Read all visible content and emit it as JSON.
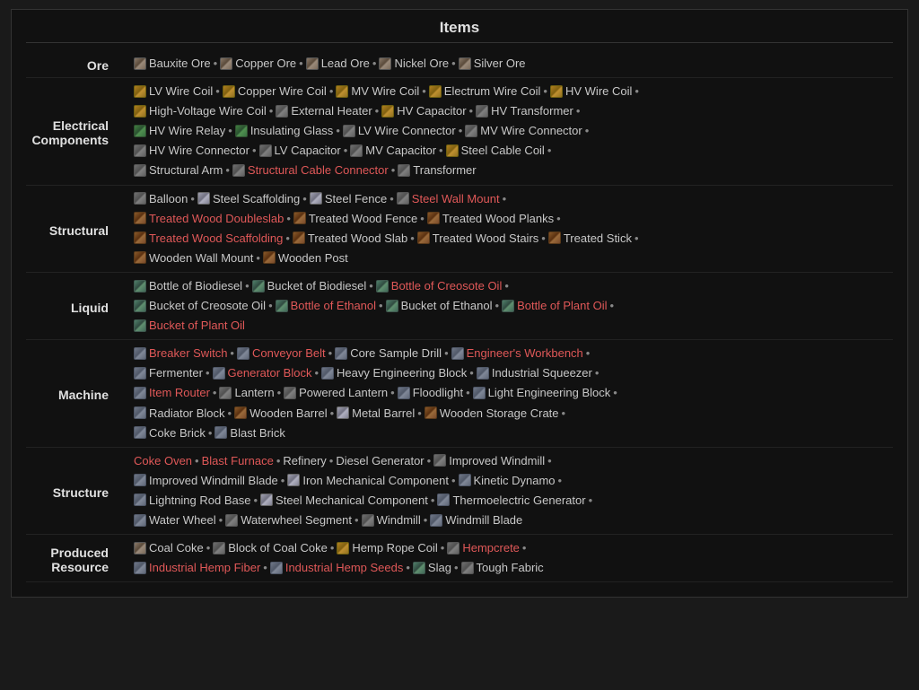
{
  "title": "Items",
  "categories": [
    {
      "id": "ore",
      "label": "Ore",
      "lines": [
        [
          {
            "icon": "ore",
            "text": "Bauxite Ore",
            "color": "white"
          },
          {
            "sep": true
          },
          {
            "icon": "ore",
            "text": "Copper Ore",
            "color": "white"
          },
          {
            "sep": true
          },
          {
            "icon": "ore",
            "text": "Lead Ore",
            "color": "white"
          },
          {
            "sep": true
          },
          {
            "icon": "ore",
            "text": "Nickel Ore",
            "color": "white"
          },
          {
            "sep": true
          },
          {
            "icon": "ore",
            "text": "Silver Ore",
            "color": "white"
          }
        ]
      ]
    },
    {
      "id": "electrical",
      "label": "Electrical\nComponents",
      "lines": [
        [
          {
            "icon": "electric",
            "text": "LV Wire Coil",
            "color": "white"
          },
          {
            "sep": true
          },
          {
            "icon": "electric",
            "text": "Copper Wire Coil",
            "color": "white"
          },
          {
            "sep": true
          },
          {
            "icon": "electric",
            "text": "MV Wire Coil",
            "color": "white"
          },
          {
            "sep": true
          },
          {
            "icon": "electric",
            "text": "Electrum Wire Coil",
            "color": "white"
          },
          {
            "sep": true
          },
          {
            "icon": "electric",
            "text": "HV Wire Coil",
            "color": "white"
          },
          {
            "sep": true
          }
        ],
        [
          {
            "icon": "electric",
            "text": "High-Voltage Wire Coil",
            "color": "white"
          },
          {
            "sep": true
          },
          {
            "icon": "generic",
            "text": "External Heater",
            "color": "white"
          },
          {
            "sep": true
          },
          {
            "icon": "electric",
            "text": "HV Capacitor",
            "color": "white"
          },
          {
            "sep": true
          },
          {
            "icon": "generic",
            "text": "HV Transformer",
            "color": "white"
          },
          {
            "sep": true
          }
        ],
        [
          {
            "icon": "green",
            "text": "HV Wire Relay",
            "color": "white"
          },
          {
            "sep": true
          },
          {
            "icon": "green",
            "text": "Insulating Glass",
            "color": "white"
          },
          {
            "sep": true
          },
          {
            "icon": "generic",
            "text": "LV Wire Connector",
            "color": "white"
          },
          {
            "sep": true
          },
          {
            "icon": "generic",
            "text": "MV Wire Connector",
            "color": "white"
          },
          {
            "sep": true
          }
        ],
        [
          {
            "icon": "generic",
            "text": "HV Wire Connector",
            "color": "white"
          },
          {
            "sep": true
          },
          {
            "icon": "generic",
            "text": "LV Capacitor",
            "color": "white"
          },
          {
            "sep": true
          },
          {
            "icon": "generic",
            "text": "MV Capacitor",
            "color": "white"
          },
          {
            "sep": true
          },
          {
            "icon": "electric",
            "text": "Steel Cable Coil",
            "color": "white"
          },
          {
            "sep": true
          }
        ],
        [
          {
            "icon": "generic",
            "text": "Structural Arm",
            "color": "white"
          },
          {
            "sep": true
          },
          {
            "icon": "generic",
            "text": "Structural Cable Connector",
            "color": "red"
          },
          {
            "sep": true
          },
          {
            "icon": "generic",
            "text": "Transformer",
            "color": "white"
          }
        ]
      ]
    },
    {
      "id": "structural",
      "label": "Structural",
      "lines": [
        [
          {
            "icon": "generic",
            "text": "Balloon",
            "color": "white"
          },
          {
            "sep": true
          },
          {
            "icon": "metal",
            "text": "Steel Scaffolding",
            "color": "white"
          },
          {
            "sep": true
          },
          {
            "icon": "metal",
            "text": "Steel Fence",
            "color": "white"
          },
          {
            "sep": true
          },
          {
            "icon": "generic",
            "text": "Steel Wall Mount",
            "color": "red"
          },
          {
            "sep": true
          }
        ],
        [
          {
            "icon": "wood",
            "text": "Treated Wood Doubleslab",
            "color": "red"
          },
          {
            "sep": true
          },
          {
            "icon": "wood",
            "text": "Treated Wood Fence",
            "color": "white"
          },
          {
            "sep": true
          },
          {
            "icon": "wood",
            "text": "Treated Wood Planks",
            "color": "white"
          },
          {
            "sep": true
          }
        ],
        [
          {
            "icon": "wood",
            "text": "Treated Wood Scaffolding",
            "color": "red"
          },
          {
            "sep": true
          },
          {
            "icon": "wood",
            "text": "Treated Wood Slab",
            "color": "white"
          },
          {
            "sep": true
          },
          {
            "icon": "wood",
            "text": "Treated Wood Stairs",
            "color": "white"
          },
          {
            "sep": true
          },
          {
            "icon": "wood",
            "text": "Treated Stick",
            "color": "white"
          },
          {
            "sep": true
          }
        ],
        [
          {
            "icon": "wood",
            "text": "Wooden Wall Mount",
            "color": "white"
          },
          {
            "sep": true
          },
          {
            "icon": "wood",
            "text": "Wooden Post",
            "color": "white"
          }
        ]
      ]
    },
    {
      "id": "liquid",
      "label": "Liquid",
      "lines": [
        [
          {
            "icon": "liquid",
            "text": "Bottle of Biodiesel",
            "color": "white"
          },
          {
            "sep": true
          },
          {
            "icon": "liquid",
            "text": "Bucket of Biodiesel",
            "color": "white"
          },
          {
            "sep": true
          },
          {
            "icon": "liquid",
            "text": "Bottle of Creosote Oil",
            "color": "red"
          },
          {
            "sep": true
          }
        ],
        [
          {
            "icon": "liquid",
            "text": "Bucket of Creosote Oil",
            "color": "white"
          },
          {
            "sep": true
          },
          {
            "icon": "liquid",
            "text": "Bottle of Ethanol",
            "color": "red"
          },
          {
            "sep": true
          },
          {
            "icon": "liquid",
            "text": "Bucket of Ethanol",
            "color": "white"
          },
          {
            "sep": true
          },
          {
            "icon": "liquid",
            "text": "Bottle of Plant Oil",
            "color": "red"
          },
          {
            "sep": true
          }
        ],
        [
          {
            "icon": "liquid",
            "text": "Bucket of Plant Oil",
            "color": "red"
          }
        ]
      ]
    },
    {
      "id": "machine",
      "label": "Machine",
      "lines": [
        [
          {
            "icon": "machine",
            "text": "Breaker Switch",
            "color": "red"
          },
          {
            "sep": true
          },
          {
            "icon": "machine",
            "text": "Conveyor Belt",
            "color": "red"
          },
          {
            "sep": true
          },
          {
            "icon": "machine",
            "text": "Core Sample Drill",
            "color": "white"
          },
          {
            "sep": true
          },
          {
            "icon": "machine",
            "text": "Engineer's Workbench",
            "color": "red"
          },
          {
            "sep": true
          }
        ],
        [
          {
            "icon": "machine",
            "text": "Fermenter",
            "color": "white"
          },
          {
            "sep": true
          },
          {
            "icon": "machine",
            "text": "Generator Block",
            "color": "red"
          },
          {
            "sep": true
          },
          {
            "icon": "machine",
            "text": "Heavy Engineering Block",
            "color": "white"
          },
          {
            "sep": true
          },
          {
            "icon": "machine",
            "text": "Industrial Squeezer",
            "color": "white"
          },
          {
            "sep": true
          }
        ],
        [
          {
            "icon": "machine",
            "text": "Item Router",
            "color": "red"
          },
          {
            "sep": true
          },
          {
            "icon": "generic",
            "text": "Lantern",
            "color": "white"
          },
          {
            "sep": true
          },
          {
            "icon": "generic",
            "text": "Powered Lantern",
            "color": "white"
          },
          {
            "sep": true
          },
          {
            "icon": "machine",
            "text": "Floodlight",
            "color": "white"
          },
          {
            "sep": true
          },
          {
            "icon": "machine",
            "text": "Light Engineering Block",
            "color": "white"
          },
          {
            "sep": true
          }
        ],
        [
          {
            "icon": "machine",
            "text": "Radiator Block",
            "color": "white"
          },
          {
            "sep": true
          },
          {
            "icon": "wood",
            "text": "Wooden Barrel",
            "color": "white"
          },
          {
            "sep": true
          },
          {
            "icon": "metal",
            "text": "Metal Barrel",
            "color": "white"
          },
          {
            "sep": true
          },
          {
            "icon": "wood",
            "text": "Wooden Storage Crate",
            "color": "white"
          },
          {
            "sep": true
          }
        ],
        [
          {
            "icon": "machine",
            "text": "Coke Brick",
            "color": "white"
          },
          {
            "sep": true
          },
          {
            "icon": "machine",
            "text": "Blast Brick",
            "color": "white"
          }
        ]
      ]
    },
    {
      "id": "structure",
      "label": "Structure",
      "lines": [
        [
          {
            "icon": null,
            "text": "Coke Oven",
            "color": "red"
          },
          {
            "sep2": true
          },
          {
            "icon": null,
            "text": "Blast Furnace",
            "color": "red"
          },
          {
            "sep2": true
          },
          {
            "icon": null,
            "text": "Refinery",
            "color": "white"
          },
          {
            "sep2": true
          },
          {
            "icon": null,
            "text": "Diesel Generator",
            "color": "white"
          },
          {
            "sep2": true
          },
          {
            "icon": "generic",
            "text": "Improved Windmill",
            "color": "white"
          },
          {
            "sep": true
          }
        ],
        [
          {
            "icon": "machine",
            "text": "Improved Windmill Blade",
            "color": "white"
          },
          {
            "sep": true
          },
          {
            "icon": "metal",
            "text": "Iron Mechanical Component",
            "color": "white"
          },
          {
            "sep": true
          },
          {
            "icon": "machine",
            "text": "Kinetic Dynamo",
            "color": "white"
          },
          {
            "sep": true
          }
        ],
        [
          {
            "icon": "machine",
            "text": "Lightning Rod Base",
            "color": "white"
          },
          {
            "sep": true
          },
          {
            "icon": "metal",
            "text": "Steel Mechanical Component",
            "color": "white"
          },
          {
            "sep": true
          },
          {
            "icon": "machine",
            "text": "Thermoelectric Generator",
            "color": "white"
          },
          {
            "sep": true
          }
        ],
        [
          {
            "icon": "machine",
            "text": "Water Wheel",
            "color": "white"
          },
          {
            "sep": true
          },
          {
            "icon": "generic",
            "text": "Waterwheel Segment",
            "color": "white"
          },
          {
            "sep": true
          },
          {
            "icon": "generic",
            "text": "Windmill",
            "color": "white"
          },
          {
            "sep": true
          },
          {
            "icon": "machine",
            "text": "Windmill Blade",
            "color": "white"
          }
        ]
      ]
    },
    {
      "id": "produced",
      "label": "Produced\nResource",
      "lines": [
        [
          {
            "icon": "ore",
            "text": "Coal Coke",
            "color": "white"
          },
          {
            "sep": true
          },
          {
            "icon": "generic",
            "text": "Block of Coal Coke",
            "color": "white"
          },
          {
            "sep": true
          },
          {
            "icon": "electric",
            "text": "Hemp Rope Coil",
            "color": "white"
          },
          {
            "sep": true
          },
          {
            "icon": "generic",
            "text": "Hempcrete",
            "color": "red"
          },
          {
            "sep": true
          }
        ],
        [
          {
            "icon": "machine",
            "text": "Industrial Hemp Fiber",
            "color": "red"
          },
          {
            "sep": true
          },
          {
            "icon": "machine",
            "text": "Industrial Hemp Seeds",
            "color": "red"
          },
          {
            "sep": true
          },
          {
            "icon": "liquid",
            "text": "Slag",
            "color": "white"
          },
          {
            "sep": true
          },
          {
            "icon": "generic",
            "text": "Tough Fabric",
            "color": "white"
          }
        ]
      ]
    }
  ]
}
